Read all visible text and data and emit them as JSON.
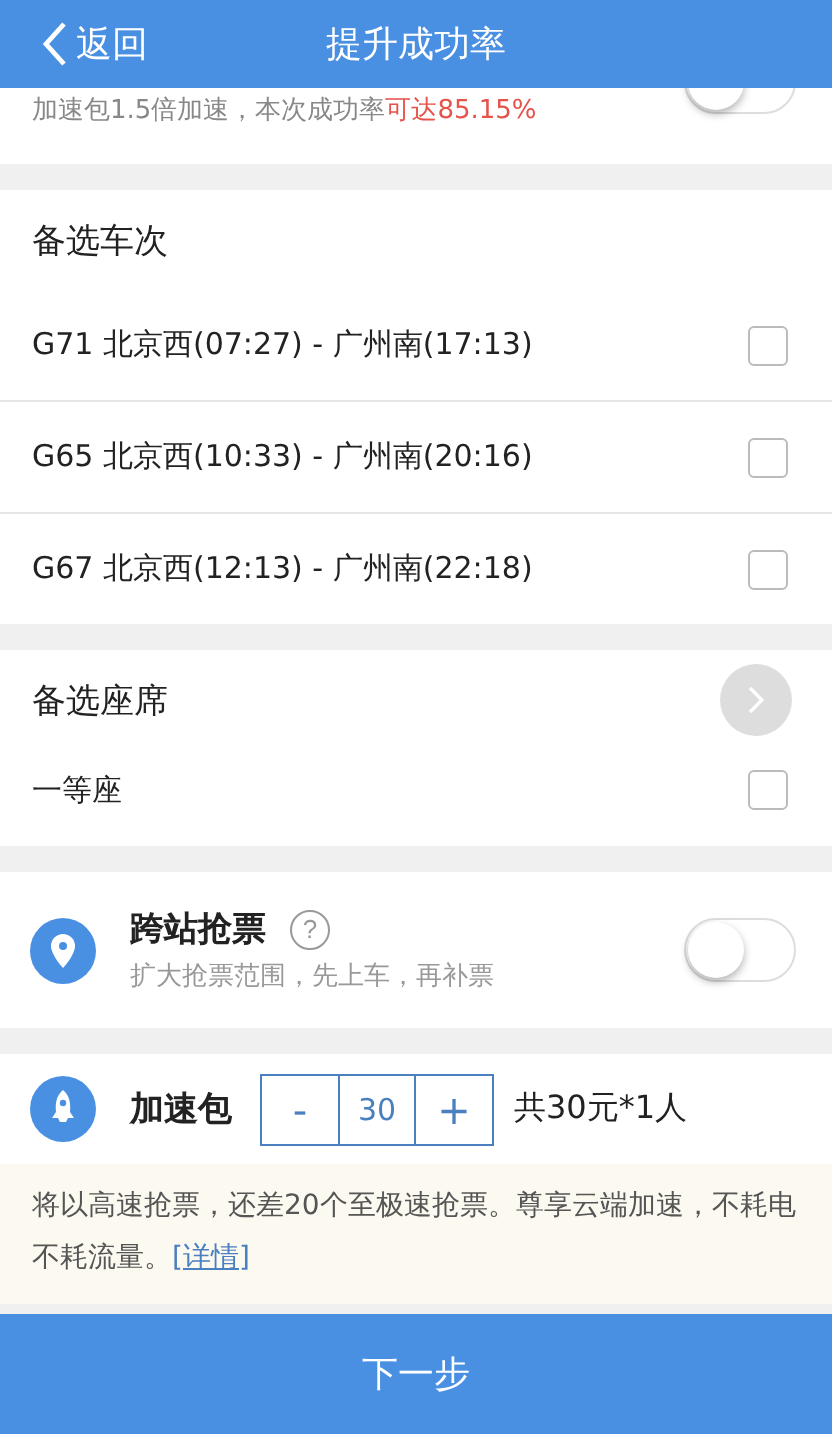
{
  "nav": {
    "back": "返回",
    "title": "提升成功率"
  },
  "boost_row": {
    "text": "加速包1.5倍加速，本次成功率",
    "highlight": "可达85.15%",
    "on": false
  },
  "trains": {
    "title": "备选车次",
    "items": [
      {
        "label": "G71  北京西(07:27) - 广州南(17:13)",
        "checked": false
      },
      {
        "label": "G65  北京西(10:33) - 广州南(20:16)",
        "checked": false
      },
      {
        "label": "G67  北京西(12:13) - 广州南(22:18)",
        "checked": false
      }
    ]
  },
  "seats": {
    "title": "备选座席",
    "items": [
      {
        "label": "一等座",
        "checked": false
      }
    ]
  },
  "cross_station": {
    "title": "跨站抢票",
    "help": "?",
    "subtitle": "扩大抢票范围，先上车，再补票",
    "on": false
  },
  "speed_pack": {
    "label": "加速包",
    "minus": "-",
    "value": "30",
    "plus": "+",
    "total": "共30元*1人"
  },
  "notice": {
    "text": "将以高速抢票，还差20个至极速抢票。尊享云端加速，不耗电不耗流量。",
    "link": "[详情]"
  },
  "next_button": "下一步"
}
